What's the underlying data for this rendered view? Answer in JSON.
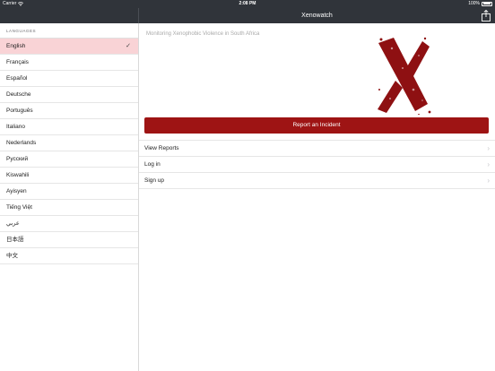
{
  "status_bar": {
    "carrier": "Carrier",
    "time": "2:08 PM",
    "battery": "100%",
    "battery_level": 1.0,
    "wifi_icon": "wifi-icon",
    "battery_icon": "battery-icon"
  },
  "nav_bar": {
    "title": "Xenowatch",
    "share_icon": "share-icon"
  },
  "sidebar": {
    "header": "LANGUAGES",
    "selected_index": 0,
    "check_icon": "checkmark-icon",
    "languages": [
      "English",
      "Français",
      "Español",
      "Deutsche",
      "Português",
      "Italiano",
      "Nederlands",
      "Русский",
      "Kiswahili",
      "Ayisyen",
      "Tiếng Việt",
      "عربي",
      "日本語",
      "中文"
    ]
  },
  "main": {
    "tagline": "Monitoring Xenophobic Violence in South Africa",
    "logo_icon": "x-logo-icon",
    "report_button": "Report an Incident",
    "menu": [
      {
        "label": "View Reports"
      },
      {
        "label": "Log in"
      },
      {
        "label": "Sign up"
      }
    ]
  },
  "colors": {
    "nav_background": "#30343a",
    "accent": "#9e1414",
    "selected_row": "#f9d3d6"
  }
}
